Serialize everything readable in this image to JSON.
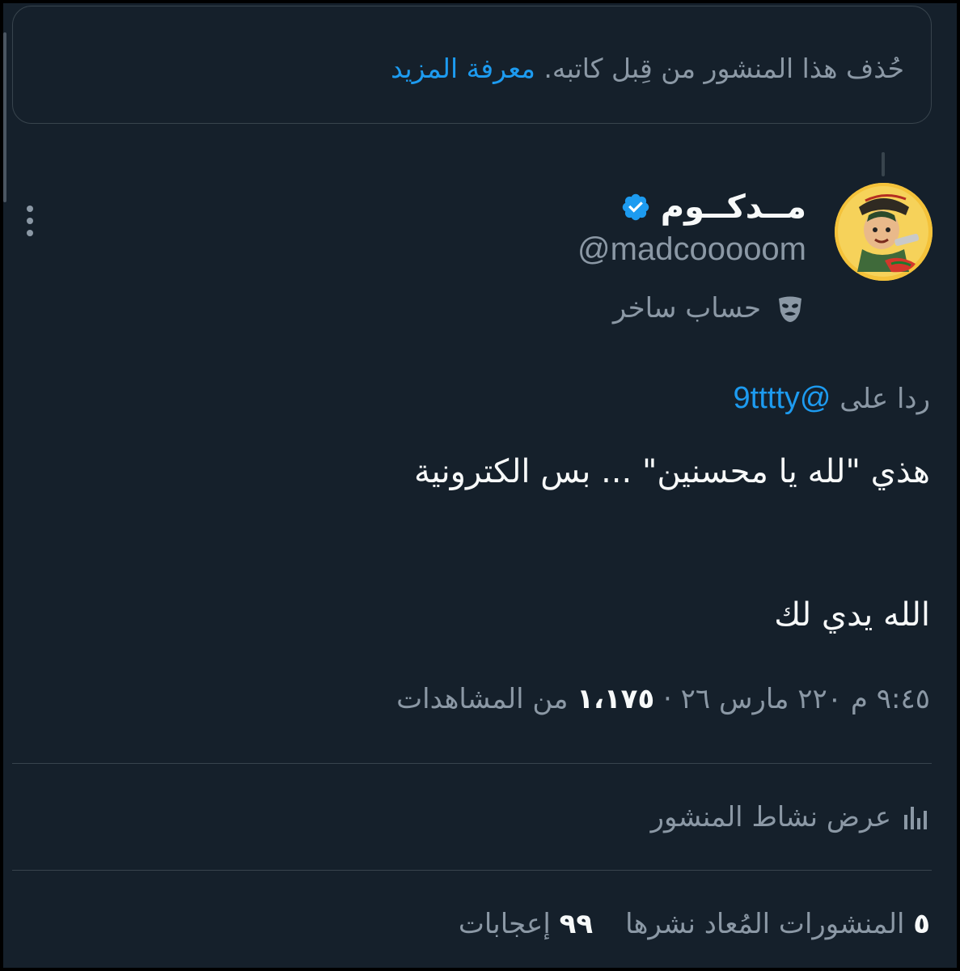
{
  "deleted_notice": {
    "text": "حُذف هذا المنشور من قِبل كاتبه.",
    "learn_more": "معرفة المزيد"
  },
  "author": {
    "display_name": "مــدكــوم",
    "handle": "@madcooooom",
    "verified": true,
    "label": "حساب ساخر",
    "label_icon": "theater-mask-icon"
  },
  "tweet": {
    "reply_prefix": "ردا على",
    "reply_handle": "@9tttty",
    "line1": "هذي \"لله يا محسنين\" ... بس الكترونية",
    "line2": "الله يدي لك",
    "time": "٩:٤٥ م",
    "date": "٢٢٠ مارس ٢٦",
    "views_count": "١،١٧٥",
    "views_label": "من المشاهدات",
    "separator": "·"
  },
  "activity": {
    "label": "عرض نشاط المنشور",
    "icon": "bar-chart-icon"
  },
  "stats": {
    "reposts_count": "٥",
    "reposts_label": "المنشورات المُعاد نشرها",
    "likes_count": "٩٩",
    "likes_label": "إعجابات"
  },
  "colors": {
    "background": "#15202b",
    "accent": "#1d9bf0",
    "secondary_text": "#8b98a5",
    "border": "#38444d"
  }
}
